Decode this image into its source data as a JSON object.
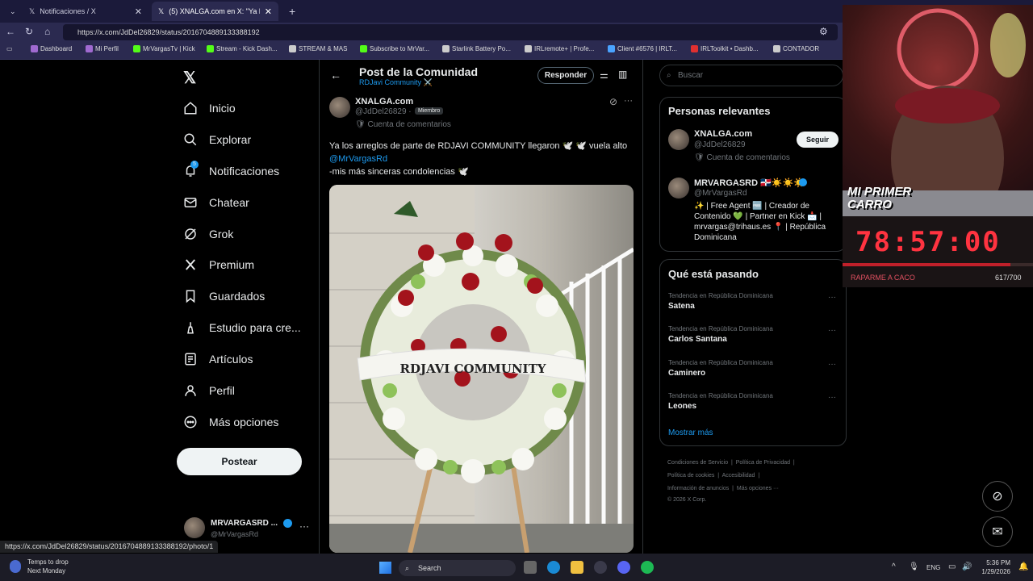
{
  "browser": {
    "tabs": [
      {
        "label": "Notificaciones / X"
      },
      {
        "label": "(5) XNALGA.com en X: \"Ya los arre"
      }
    ],
    "url": "https://x.com/JdDel26829/status/2016704889133388192",
    "bookmarks": [
      "Dashboard",
      "Mi Perfil",
      "MrVargasTv | Kick",
      "Stream - Kick Dash...",
      "STREAM & MAS",
      "Subscribe to MrVar...",
      "Starlink Battery Po...",
      "IRLremote+ | Profe...",
      "Client #6576 | IRLT...",
      "IRLToolkit • Dashb...",
      "CONTADOR"
    ],
    "status_url": "https://x.com/JdDel26829/status/2016704889133388192/photo/1"
  },
  "sidebar": {
    "items": [
      {
        "label": "Inicio"
      },
      {
        "label": "Explorar"
      },
      {
        "label": "Notificaciones",
        "badge": "5"
      },
      {
        "label": "Chatear"
      },
      {
        "label": "Grok"
      },
      {
        "label": "Premium"
      },
      {
        "label": "Guardados"
      },
      {
        "label": "Estudio para cre..."
      },
      {
        "label": "Artículos"
      },
      {
        "label": "Perfil"
      },
      {
        "label": "Más opciones"
      }
    ],
    "post_button": "Postear",
    "account": {
      "name": "MRVARGASRD ...",
      "handle": "@MrVargasRd"
    }
  },
  "post": {
    "header_title": "Post de la Comunidad",
    "header_sub": "RDJavi Community ⚔️",
    "reply_button": "Responder",
    "author_name": "XNALGA.com",
    "author_handle": "@JdDel26829 ·",
    "member_badge": "Miembro",
    "comment_account": "Cuenta de comentarios",
    "text_line1": "Ya los arreglos de parte de RDJAVI COMMUNITY llegaron 🕊️ 🕊️ vuela alto",
    "mention": "@MrVargasRd",
    "text_line3": "-mis más sinceras condolencias 🕊️",
    "ribbon_text": "RDJAVI COMMUNITY"
  },
  "right": {
    "search_placeholder": "Buscar",
    "relevant_title": "Personas relevantes",
    "people": [
      {
        "name": "XNALGA.com",
        "handle": "@JdDel26829",
        "sub": "Cuenta de comentarios",
        "follow": "Seguir"
      },
      {
        "name": "MRVARGASRD 🇩🇴☀️☀️☀️",
        "handle": "@MrVargasRd",
        "bio": "✨ | Free Agent 🆓 | Creador de Contenido 💚 | Partner en Kick 📩 | mrvargas@trihaus.es 📍 | República Dominicana"
      }
    ],
    "trends_title": "Qué está pasando",
    "trends": [
      {
        "category": "Tendencia en República Dominicana",
        "name": "Satena"
      },
      {
        "category": "Tendencia en República Dominicana",
        "name": "Carlos Santana"
      },
      {
        "category": "Tendencia en República Dominicana",
        "name": "Caminero"
      },
      {
        "category": "Tendencia en República Dominicana",
        "name": "Leones"
      }
    ],
    "show_more": "Mostrar más",
    "footer": [
      "Condiciones de Servicio",
      "Política de Privacidad",
      "Política de cookies",
      "Accesibilidad",
      "Información de anuncios",
      "Más opciones ···",
      "© 2026 X Corp."
    ]
  },
  "overlay": {
    "banner": "MI PRIMER CARRO",
    "timer": "78:57:00",
    "goal_label": "RAPARME A CACO",
    "goal_count": "617/700",
    "goal_progress": 0.88
  },
  "taskbar": {
    "weather_title": "Temps to drop",
    "weather_sub": "Next Monday",
    "search": "Search",
    "lang": "ENG",
    "time": "5:36 PM",
    "date": "1/29/2026"
  },
  "colors": {
    "accent": "#1d9bf0",
    "timer": "#ff3340",
    "browser": "#2b2a50"
  }
}
